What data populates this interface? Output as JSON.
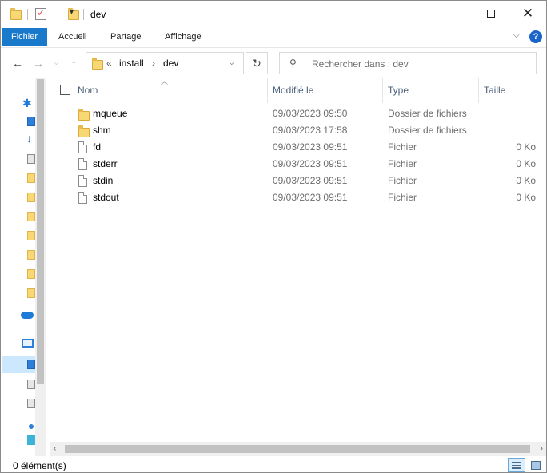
{
  "window": {
    "title": "dev",
    "controls": {
      "minimize": "",
      "maximize": "",
      "close": "✕"
    }
  },
  "ribbon": {
    "tabs": [
      {
        "label": "Fichier"
      },
      {
        "label": "Accueil"
      },
      {
        "label": "Partage"
      },
      {
        "label": "Affichage"
      }
    ],
    "help": "?"
  },
  "address": {
    "overflow": "«",
    "crumbs": [
      "install",
      "dev"
    ],
    "sep": "›"
  },
  "search": {
    "placeholder": "Rechercher dans : dev"
  },
  "list": {
    "columns": {
      "name": "Nom",
      "modified": "Modifié le",
      "type": "Type",
      "size": "Taille"
    },
    "rows": [
      {
        "kind": "folder",
        "name": "mqueue",
        "modified": "09/03/2023 09:50",
        "type": "Dossier de fichiers",
        "size": ""
      },
      {
        "kind": "folder",
        "name": "shm",
        "modified": "09/03/2023 17:58",
        "type": "Dossier de fichiers",
        "size": ""
      },
      {
        "kind": "file",
        "name": "fd",
        "modified": "09/03/2023 09:51",
        "type": "Fichier",
        "size": "0 Ko"
      },
      {
        "kind": "file",
        "name": "stderr",
        "modified": "09/03/2023 09:51",
        "type": "Fichier",
        "size": "0 Ko"
      },
      {
        "kind": "file",
        "name": "stdin",
        "modified": "09/03/2023 09:51",
        "type": "Fichier",
        "size": "0 Ko"
      },
      {
        "kind": "file",
        "name": "stdout",
        "modified": "09/03/2023 09:51",
        "type": "Fichier",
        "size": "0 Ko"
      }
    ]
  },
  "status": {
    "count": "0 élément(s)"
  },
  "colors": {
    "accent": "#1979ca",
    "header_text": "#4c607a",
    "muted": "#6d6d6d",
    "folder": "#f8d775"
  }
}
